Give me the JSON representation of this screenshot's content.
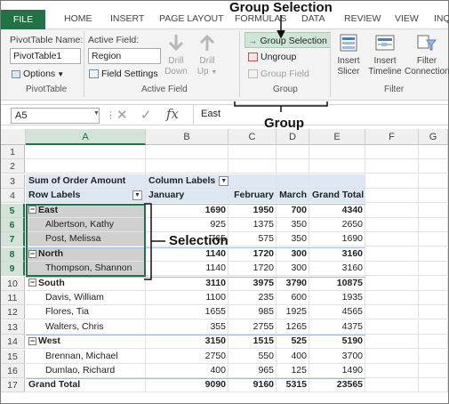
{
  "annotations": {
    "group_selection": "Group Selection",
    "group": "Group",
    "selection": "Selection"
  },
  "tabs": [
    "FILE",
    "HOME",
    "INSERT",
    "PAGE LAYOUT",
    "FORMULAS",
    "DATA",
    "REVIEW",
    "VIEW",
    "INQ"
  ],
  "ribbon": {
    "pivot_name_label": "PivotTable Name:",
    "pivot_name_value": "PivotTable1",
    "options_label": "Options",
    "pivottable_group": "PivotTable",
    "active_field_label": "Active Field:",
    "active_field_value": "Region",
    "field_settings_label": "Field Settings",
    "drill_down": [
      "Drill",
      "Down"
    ],
    "drill_up": [
      "Drill",
      "Up"
    ],
    "active_field_group": "Active Field",
    "group_selection": "Group Selection",
    "ungroup": "Ungroup",
    "group_field": "Group Field",
    "group_group": "Group",
    "insert_slicer": [
      "Insert",
      "Slicer"
    ],
    "insert_timeline": [
      "Insert",
      "Timeline"
    ],
    "filter_connections": [
      "Filter",
      "Connections"
    ],
    "filter_group": "Filter"
  },
  "formula_bar": {
    "name_box": "A5",
    "fx": "fx",
    "content": "East"
  },
  "columns": [
    "A",
    "B",
    "C",
    "D",
    "E",
    "F",
    "G"
  ],
  "rows": [
    "1",
    "2",
    "3",
    "4",
    "5",
    "6",
    "7",
    "8",
    "9",
    "10",
    "11",
    "12",
    "13",
    "14",
    "15",
    "16",
    "17"
  ],
  "pivot": {
    "sum_label": "Sum of Order Amount",
    "column_labels": "Column Labels",
    "row_labels": "Row Labels",
    "months": [
      "January",
      "February",
      "March",
      "Grand Total"
    ],
    "data_rows": [
      {
        "label": "East",
        "type": "group",
        "values": [
          "1690",
          "1950",
          "700",
          "4340"
        ]
      },
      {
        "label": "Albertson, Kathy",
        "type": "item",
        "values": [
          "925",
          "1375",
          "350",
          "2650"
        ]
      },
      {
        "label": "Post, Melissa",
        "type": "item",
        "values": [
          "765",
          "575",
          "350",
          "1690"
        ]
      },
      {
        "label": "North",
        "type": "group",
        "values": [
          "1140",
          "1720",
          "300",
          "3160"
        ]
      },
      {
        "label": "Thompson, Shannon",
        "type": "item",
        "values": [
          "1140",
          "1720",
          "300",
          "3160"
        ]
      },
      {
        "label": "South",
        "type": "group",
        "values": [
          "3110",
          "3975",
          "3790",
          "10875"
        ]
      },
      {
        "label": "Davis, William",
        "type": "item",
        "values": [
          "1100",
          "235",
          "600",
          "1935"
        ]
      },
      {
        "label": "Flores, Tia",
        "type": "item",
        "values": [
          "1655",
          "985",
          "1925",
          "4565"
        ]
      },
      {
        "label": "Walters, Chris",
        "type": "item",
        "values": [
          "355",
          "2755",
          "1265",
          "4375"
        ]
      },
      {
        "label": "West",
        "type": "group",
        "values": [
          "3150",
          "1515",
          "525",
          "5190"
        ]
      },
      {
        "label": "Brennan, Michael",
        "type": "item",
        "values": [
          "2750",
          "550",
          "400",
          "3700"
        ]
      },
      {
        "label": "Dumlao, Richard",
        "type": "item",
        "values": [
          "400",
          "965",
          "125",
          "1490"
        ]
      },
      {
        "label": "Grand Total",
        "type": "total",
        "values": [
          "9090",
          "9160",
          "5315",
          "23565"
        ]
      }
    ]
  }
}
